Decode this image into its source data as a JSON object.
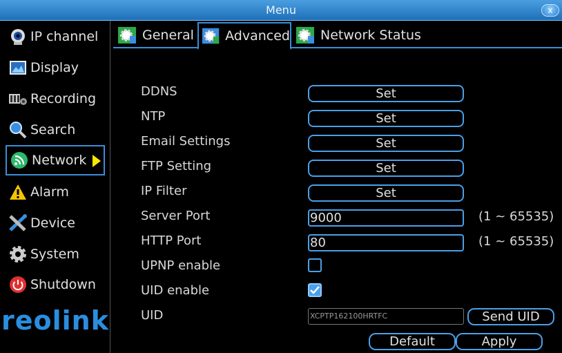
{
  "window": {
    "title": "Menu",
    "close_label": "x"
  },
  "sidebar": {
    "items": [
      {
        "label": "IP channel",
        "icon": "webcam-icon"
      },
      {
        "label": "Display",
        "icon": "display-icon"
      },
      {
        "label": "Recording",
        "icon": "recording-icon"
      },
      {
        "label": "Search",
        "icon": "search-icon"
      },
      {
        "label": "Network",
        "icon": "network-icon",
        "active": true
      },
      {
        "label": "Alarm",
        "icon": "alarm-icon"
      },
      {
        "label": "Device",
        "icon": "device-icon"
      },
      {
        "label": "System",
        "icon": "gear-icon"
      },
      {
        "label": "Shutdown",
        "icon": "power-icon"
      }
    ],
    "logo": "reolink"
  },
  "tabs": [
    {
      "label": "General"
    },
    {
      "label": "Advanced",
      "active": true
    },
    {
      "label": "Network Status"
    }
  ],
  "form": {
    "ddns": {
      "label": "DDNS",
      "button": "Set"
    },
    "ntp": {
      "label": "NTP",
      "button": "Set"
    },
    "email": {
      "label": "Email Settings",
      "button": "Set"
    },
    "ftp": {
      "label": "FTP Setting",
      "button": "Set"
    },
    "ipfilter": {
      "label": "IP Filter",
      "button": "Set"
    },
    "server_port": {
      "label": "Server Port",
      "value": "9000",
      "range": "(1 ~ 65535)"
    },
    "http_port": {
      "label": "HTTP Port",
      "value": "80",
      "range": "(1 ~ 65535)"
    },
    "upnp": {
      "label": "UPNP enable",
      "checked": false
    },
    "uid_enable": {
      "label": "UID enable",
      "checked": true
    },
    "uid": {
      "label": "UID",
      "value": "XCPTP162100HRTFC",
      "send_button": "Send UID"
    }
  },
  "footer": {
    "default_label": "Default",
    "apply_label": "Apply"
  },
  "colors": {
    "accent": "#4aa0e8",
    "titlebar": "#2f86cf",
    "logo": "#2a8ee0",
    "arrow": "#ffe800"
  }
}
